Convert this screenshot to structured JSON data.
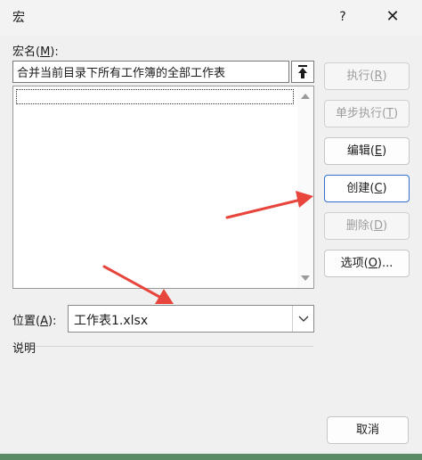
{
  "window": {
    "title": "宏",
    "help": "?",
    "close": "✕"
  },
  "macro_name": {
    "label_prefix": "宏名(",
    "label_key": "M",
    "label_suffix": "):",
    "value": "合并当前目录下所有工作簿的全部工作表"
  },
  "location": {
    "label_prefix": "位置(",
    "label_key": "A",
    "label_suffix": "):",
    "value": "工作表1.xlsx"
  },
  "description": {
    "label": "说明"
  },
  "buttons": {
    "run": {
      "prefix": "执行(",
      "key": "R",
      "suffix": ")"
    },
    "step_into": {
      "prefix": "单步执行(",
      "key": "T",
      "suffix": ")"
    },
    "edit": {
      "prefix": "编辑(",
      "key": "E",
      "suffix": ")"
    },
    "create": {
      "prefix": "创建(",
      "key": "C",
      "suffix": ")"
    },
    "delete": {
      "prefix": "删除(",
      "key": "D",
      "suffix": ")"
    },
    "options": {
      "prefix": "选项(",
      "key": "O",
      "suffix": ")..."
    },
    "cancel": {
      "label": "取消"
    }
  },
  "colors": {
    "arrow": "#e8453c",
    "default_button_border": "#2f6fd0",
    "disabled_text": "#9d9d9d"
  }
}
